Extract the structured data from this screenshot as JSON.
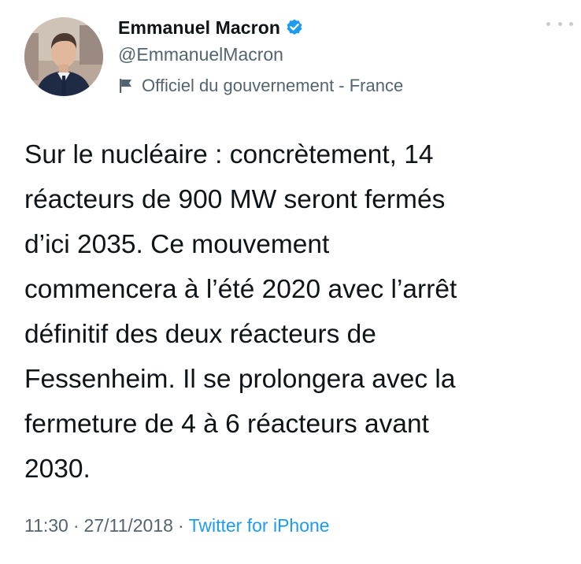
{
  "author": {
    "display_name": "Emmanuel Macron",
    "handle": "@EmmanuelMacron",
    "affiliation": "Officiel du gouvernement - France",
    "verified": true,
    "avatar_icon": "profile-photo"
  },
  "tweet": {
    "lines": [
      "Sur le nucléaire : concrètement, 14",
      "réacteurs de 900 MW seront fermés",
      "d’ici 2035. Ce mouvement",
      "commencera à l’été 2020 avec l’arrêt",
      "définitif des deux réacteurs de",
      "Fessenheim. Il se prolongera avec la",
      "fermeture de 4 à 6 réacteurs avant",
      "2030."
    ]
  },
  "meta": {
    "time": "11:30",
    "separator": "·",
    "date": "27/11/2018",
    "source": "Twitter for iPhone"
  },
  "colors": {
    "text": "#0f1419",
    "secondary": "#536471",
    "link": "#1d9bf0",
    "verified_badge": "#1d9bf0"
  },
  "icons": {
    "verified": "verified-badge-icon",
    "label": "flag-icon",
    "more": "more-options-icon"
  }
}
